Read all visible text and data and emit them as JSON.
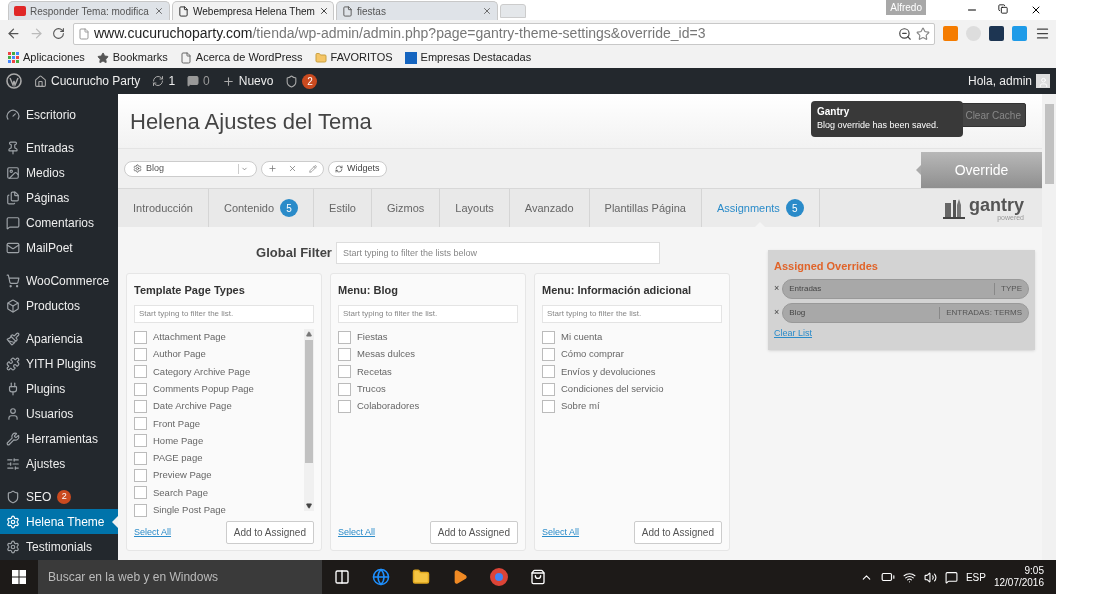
{
  "browser": {
    "profile": "Alfredo",
    "tabs": [
      {
        "title": "Responder Tema: modifica",
        "selected": false
      },
      {
        "title": "Webempresa Helena Them",
        "selected": true
      },
      {
        "title": "fiestas",
        "selected": false
      }
    ],
    "url_host": "www.cucuruchoparty.com",
    "url_path": "/tienda/wp-admin/admin.php?page=gantry-theme-settings&override_id=3",
    "bookmarks": [
      "Aplicaciones",
      "Bookmarks",
      "Acerca de WordPress",
      "FAVORITOS",
      "Empresas Destacadas"
    ]
  },
  "admin_bar": {
    "site": "Cucurucho Party",
    "updates": "1",
    "comments": "0",
    "new": "Nuevo",
    "seo_count": "2",
    "greeting": "Hola, admin"
  },
  "sidebar": {
    "groups": [
      [
        {
          "label": "Escritorio",
          "selected": false
        }
      ],
      [
        {
          "label": "Entradas",
          "selected": false
        },
        {
          "label": "Medios",
          "selected": false
        },
        {
          "label": "Páginas",
          "selected": false
        },
        {
          "label": "Comentarios",
          "selected": false
        },
        {
          "label": "MailPoet",
          "selected": false
        }
      ],
      [
        {
          "label": "WooCommerce",
          "selected": false
        },
        {
          "label": "Productos",
          "selected": false
        }
      ],
      [
        {
          "label": "Apariencia",
          "selected": false
        },
        {
          "label": "YITH Plugins",
          "selected": false
        },
        {
          "label": "Plugins",
          "selected": false
        },
        {
          "label": "Usuarios",
          "selected": false
        },
        {
          "label": "Herramientas",
          "selected": false
        },
        {
          "label": "Ajustes",
          "selected": false
        }
      ],
      [
        {
          "label": "SEO",
          "badge": "2",
          "selected": false
        },
        {
          "label": "Helena Theme",
          "selected": true
        },
        {
          "label": "Testimonials",
          "selected": false
        }
      ]
    ]
  },
  "page": {
    "title": "Helena Ajustes del Tema",
    "clear_cache": "Clear Cache",
    "toast": {
      "title": "Gantry",
      "message": "Blog override has been saved."
    },
    "override_select": "Blog",
    "widgets": "Widgets",
    "override": "Override",
    "tabs": [
      {
        "label": "Introducción",
        "selected": false
      },
      {
        "label": "Contenido",
        "badge": "5",
        "selected": false
      },
      {
        "label": "Estilo",
        "selected": false
      },
      {
        "label": "Gizmos",
        "selected": false
      },
      {
        "label": "Layouts",
        "selected": false
      },
      {
        "label": "Avanzado",
        "selected": false
      },
      {
        "label": "Plantillas Página",
        "selected": false
      },
      {
        "label": "Assignments",
        "badge": "5",
        "selected": true
      }
    ],
    "logo": {
      "word": "gantry",
      "sub": "powered"
    },
    "global_filter": {
      "label": "Global Filter",
      "placeholder": "Start typing to filter the lists below"
    },
    "panels": [
      {
        "title": "Template Page Types",
        "placeholder": "Start typing to filter the list.",
        "scrollable": true,
        "select_all": "Select All",
        "add": "Add to Assigned",
        "items": [
          {
            "label": "Attachment Page",
            "checked": false
          },
          {
            "label": "Author Page",
            "checked": false
          },
          {
            "label": "Category Archive Page",
            "checked": false
          },
          {
            "label": "Comments Popup Page",
            "checked": false
          },
          {
            "label": "Date Archive Page",
            "checked": false
          },
          {
            "label": "Front Page",
            "checked": false
          },
          {
            "label": "Home Page",
            "checked": false
          },
          {
            "label": "PAGE page",
            "checked": false
          },
          {
            "label": "Preview Page",
            "checked": false
          },
          {
            "label": "Search Page",
            "checked": false
          },
          {
            "label": "Single Post Page",
            "checked": false
          }
        ]
      },
      {
        "title": "Menu: Blog",
        "placeholder": "Start typing to filter the list.",
        "scrollable": false,
        "select_all": "Select All",
        "add": "Add to Assigned",
        "items": [
          {
            "label": "Fiestas",
            "checked": false
          },
          {
            "label": "Mesas dulces",
            "checked": false
          },
          {
            "label": "Recetas",
            "checked": false
          },
          {
            "label": "Trucos",
            "checked": false
          },
          {
            "label": "Colaboradores",
            "checked": false
          }
        ]
      },
      {
        "title": "Menu: Información adicional",
        "placeholder": "Start typing to filter the list.",
        "scrollable": false,
        "select_all": "Select All",
        "add": "Add to Assigned",
        "items": [
          {
            "label": "Mi cuenta",
            "checked": false
          },
          {
            "label": "Cómo comprar",
            "checked": false
          },
          {
            "label": "Envíos y devoluciones",
            "checked": false
          },
          {
            "label": "Condiciones del servicio",
            "checked": false
          },
          {
            "label": "Sobre mí",
            "checked": false
          }
        ]
      }
    ],
    "assigned": {
      "title": "Assigned Overrides",
      "clear": "Clear List",
      "items": [
        {
          "remove": "×",
          "label": "Entradas",
          "type": "TYPE"
        },
        {
          "remove": "×",
          "label": "Blog",
          "type": "ENTRADAS: TERMS"
        }
      ]
    }
  },
  "taskbar": {
    "search": "Buscar en la web y en Windows",
    "lang": "ESP",
    "time": "9:05",
    "date": "12/07/2016"
  }
}
